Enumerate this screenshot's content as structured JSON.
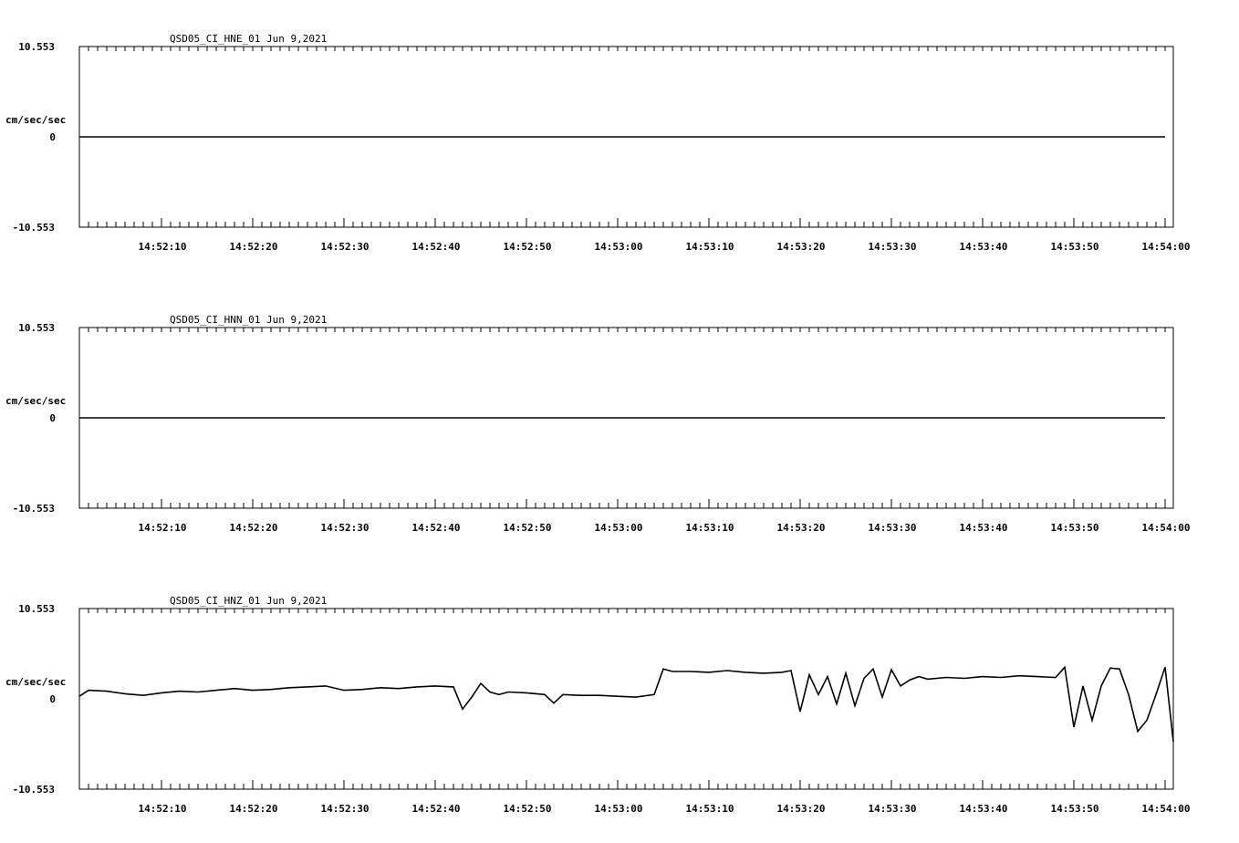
{
  "chart_data": [
    {
      "type": "line",
      "title": "QSD05_CI_HNE_01  Jun 9,2021",
      "ylabel": "cm/sec/sec",
      "y_tick_labels": [
        "10.553",
        "0",
        "-10.553"
      ],
      "ylim": [
        -10.553,
        10.553
      ],
      "x_tick_labels": [
        "14:52:10",
        "14:52:20",
        "14:52:30",
        "14:52:40",
        "14:52:50",
        "14:53:00",
        "14:53:10",
        "14:53:20",
        "14:53:30",
        "14:53:40",
        "14:53:50",
        "14:54:00"
      ],
      "x": [
        "14:52:01",
        "14:54:00"
      ],
      "series": [
        {
          "values": [
            0,
            0
          ]
        }
      ]
    },
    {
      "type": "line",
      "title": "QSD05_CI_HNN_01  Jun 9,2021",
      "ylabel": "cm/sec/sec",
      "y_tick_labels": [
        "10.553",
        "0",
        "-10.553"
      ],
      "ylim": [
        -10.553,
        10.553
      ],
      "x_tick_labels": [
        "14:52:10",
        "14:52:20",
        "14:52:30",
        "14:52:40",
        "14:52:50",
        "14:53:00",
        "14:53:10",
        "14:53:20",
        "14:53:30",
        "14:53:40",
        "14:53:50",
        "14:54:00"
      ],
      "x": [
        "14:52:01",
        "14:54:00"
      ],
      "series": [
        {
          "values": [
            0,
            0
          ]
        }
      ]
    },
    {
      "type": "line",
      "title": "QSD05_CI_HNZ_01  Jun 9,2021",
      "ylabel": "cm/sec/sec",
      "y_tick_labels": [
        "10.553",
        "0",
        "-10.553"
      ],
      "ylim": [
        -10.553,
        10.553
      ],
      "x_tick_labels": [
        "14:52:10",
        "14:52:20",
        "14:52:30",
        "14:52:40",
        "14:52:50",
        "14:53:00",
        "14:53:10",
        "14:53:20",
        "14:53:30",
        "14:53:40",
        "14:53:50",
        "14:54:00"
      ],
      "x": [
        "14:52:01",
        "14:52:02",
        "14:52:04",
        "14:52:06",
        "14:52:08",
        "14:52:10",
        "14:52:12",
        "14:52:14",
        "14:52:16",
        "14:52:18",
        "14:52:20",
        "14:52:22",
        "14:52:24",
        "14:52:26",
        "14:52:28",
        "14:52:30",
        "14:52:32",
        "14:52:34",
        "14:52:36",
        "14:52:38",
        "14:52:40",
        "14:52:42",
        "14:52:43",
        "14:52:44",
        "14:52:45",
        "14:52:46",
        "14:52:47",
        "14:52:48",
        "14:52:50",
        "14:52:52",
        "14:52:53",
        "14:52:54",
        "14:52:56",
        "14:52:58",
        "14:53:00",
        "14:53:02",
        "14:53:04",
        "14:53:05",
        "14:53:06",
        "14:53:08",
        "14:53:10",
        "14:53:12",
        "14:53:14",
        "14:53:16",
        "14:53:18",
        "14:53:19",
        "14:53:20",
        "14:53:21",
        "14:53:22",
        "14:53:23",
        "14:53:24",
        "14:53:25",
        "14:53:26",
        "14:53:27",
        "14:53:28",
        "14:53:29",
        "14:53:30",
        "14:53:31",
        "14:53:32",
        "14:53:33",
        "14:53:34",
        "14:53:36",
        "14:53:38",
        "14:53:40",
        "14:53:42",
        "14:53:44",
        "14:53:46",
        "14:53:48",
        "14:53:49",
        "14:53:50",
        "14:53:51",
        "14:53:52",
        "14:53:53",
        "14:53:54",
        "14:53:55",
        "14:53:56",
        "14:53:57",
        "14:53:58",
        "14:53:59",
        "14:54:00",
        "14:54:01"
      ],
      "series": [
        {
          "values": [
            0.3,
            1.0,
            0.9,
            0.6,
            0.4,
            0.7,
            0.9,
            0.8,
            1.0,
            1.2,
            1.0,
            1.1,
            1.3,
            1.4,
            1.5,
            1.0,
            1.1,
            1.3,
            1.2,
            1.4,
            1.5,
            1.4,
            -1.2,
            0.2,
            1.8,
            0.8,
            0.5,
            0.8,
            0.7,
            0.5,
            -0.5,
            0.5,
            0.4,
            0.4,
            0.3,
            0.2,
            0.5,
            3.5,
            3.2,
            3.2,
            3.1,
            3.3,
            3.1,
            3.0,
            3.1,
            3.3,
            -1.5,
            2.8,
            0.5,
            2.6,
            -0.6,
            3.0,
            -0.8,
            2.4,
            3.5,
            0.2,
            3.4,
            1.5,
            2.2,
            2.6,
            2.3,
            2.5,
            2.4,
            2.6,
            2.5,
            2.7,
            2.6,
            2.5,
            3.7,
            -3.3,
            1.5,
            -2.5,
            1.5,
            3.6,
            3.5,
            0.5,
            -3.8,
            -2.5,
            0.5,
            3.7,
            -5.0
          ]
        }
      ]
    }
  ]
}
